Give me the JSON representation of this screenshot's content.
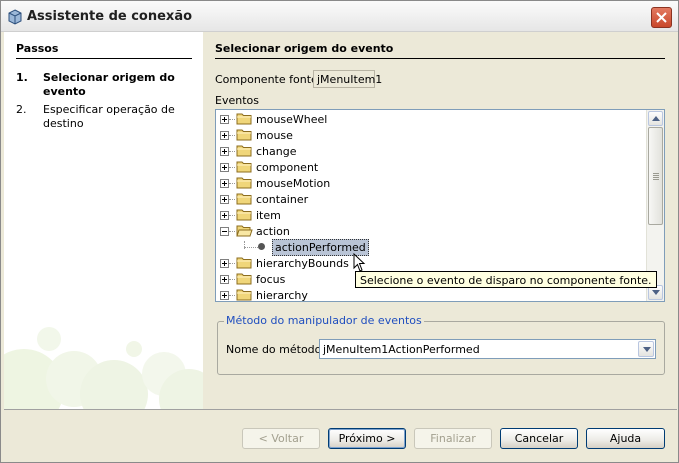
{
  "window": {
    "title": "Assistente de conexão",
    "icons": {
      "app": "app-cube-icon",
      "close": "close-icon"
    }
  },
  "steps": {
    "heading": "Passos",
    "items": [
      {
        "num": "1.",
        "label": "Selecionar origem do evento",
        "active": true
      },
      {
        "num": "2.",
        "label": "Especificar operação de destino",
        "active": false
      }
    ]
  },
  "main": {
    "heading": "Selecionar origem do evento",
    "component_label": "Componente fonte:",
    "component_value": "jMenuItem1",
    "events_label": "Eventos",
    "events": [
      {
        "label": "mouseWheel",
        "expanded": false
      },
      {
        "label": "mouse",
        "expanded": false
      },
      {
        "label": "change",
        "expanded": false
      },
      {
        "label": "component",
        "expanded": false
      },
      {
        "label": "mouseMotion",
        "expanded": false
      },
      {
        "label": "container",
        "expanded": false
      },
      {
        "label": "item",
        "expanded": false
      },
      {
        "label": "action",
        "expanded": true
      },
      {
        "label": "actionPerformed",
        "leaf": true,
        "selected": true
      },
      {
        "label": "hierarchyBounds",
        "expanded": false
      },
      {
        "label": "focus",
        "expanded": false
      },
      {
        "label": "hierarchy",
        "expanded": false
      }
    ],
    "tooltip": "Selecione o evento de disparo no componente fonte.",
    "handler_group_title": "Método do manipulador de eventos",
    "method_label": "Nome do método:",
    "method_value": "jMenuItem1ActionPerformed"
  },
  "buttons": {
    "back": "< Voltar",
    "next": "Próximo >",
    "finish": "Finalizar",
    "cancel": "Cancelar",
    "help": "Ajuda"
  },
  "colors": {
    "selection": "#b9c4d6",
    "tooltip_bg": "#ffffe1",
    "group_title": "#1f4ebf",
    "folder": "#f0d67a"
  }
}
